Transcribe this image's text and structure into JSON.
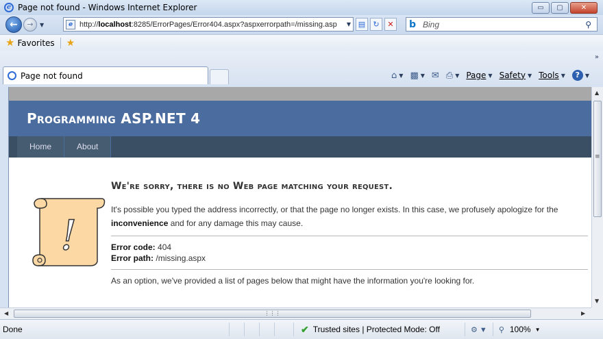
{
  "window": {
    "title": "Page not found - Windows Internet Explorer",
    "controls": {
      "minimize": "▭",
      "maximize": "▢",
      "close": "✕"
    }
  },
  "address": {
    "url_prefix": "http://",
    "url_host": "localhost",
    "url_rest": ":8285/ErrorPages/Error404.aspx?aspxerrorpath=/missing.asp"
  },
  "search": {
    "engine": "Bing",
    "go_icon": "⚲"
  },
  "favorites": {
    "label": "Favorites"
  },
  "tabs": [
    {
      "label": "Page not found"
    }
  ],
  "commands": {
    "page": "Page",
    "safety": "Safety",
    "tools": "Tools",
    "help": "?"
  },
  "site": {
    "title": "Programming ASP.NET 4",
    "menu": [
      {
        "label": "Home"
      },
      {
        "label": "About"
      }
    ]
  },
  "error": {
    "heading": "We're sorry, there is no Web page matching your request.",
    "para_start": "It's possible you typed the address incorrectly, or that the page no longer exists. In this case, we profusely apologize for the ",
    "para_bold": "inconvenience",
    "para_end": " and for any damage this may cause.",
    "code_label": "Error code:",
    "code_value": "404",
    "path_label": "Error path:",
    "path_value": "/missing.aspx",
    "option_text": "As an option, we've provided a list of pages below that might have the information you're looking for."
  },
  "scroll_glyph": "!",
  "status": {
    "text": "Done",
    "zone": "Trusted sites | Protected Mode: Off",
    "zoom": "100%"
  },
  "colors": {
    "site_header": "#4b6c9e",
    "site_menu": "#3a4f63",
    "scroll_fill": "#fcd9a4"
  }
}
